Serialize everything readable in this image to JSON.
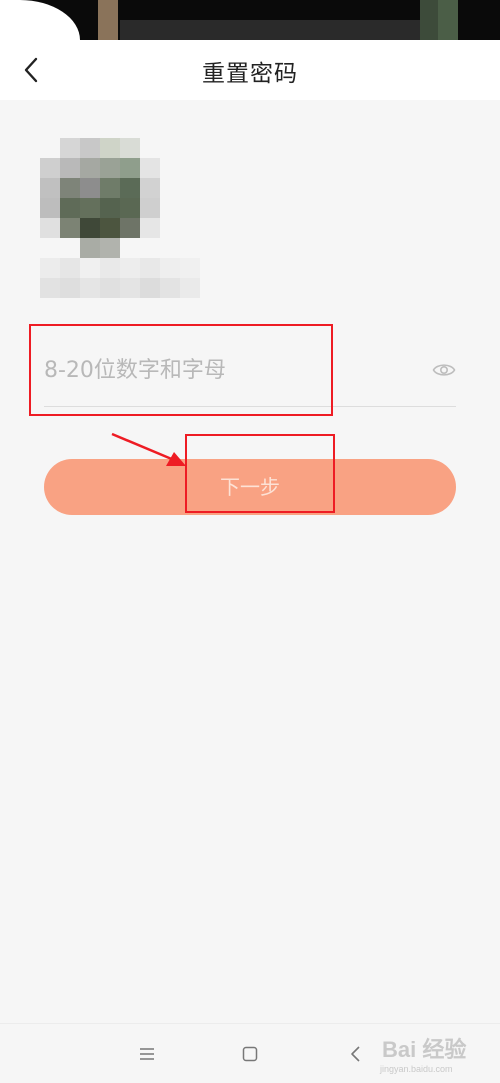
{
  "header": {
    "title": "重置密码"
  },
  "password": {
    "placeholder": "8-20位数字和字母",
    "value": ""
  },
  "next_button": {
    "label": "下一步"
  },
  "colors": {
    "accent": "#f9a283",
    "annotation": "#ee1c24",
    "background": "#f6f6f6"
  },
  "icons": {
    "back": "chevron-left-icon",
    "eye": "eye-icon",
    "nav_menu": "menu-icon",
    "nav_home": "home-icon",
    "nav_back": "back-icon"
  },
  "watermark": {
    "brand": "Bai 经验",
    "url": "jingyan.baidu.com"
  }
}
